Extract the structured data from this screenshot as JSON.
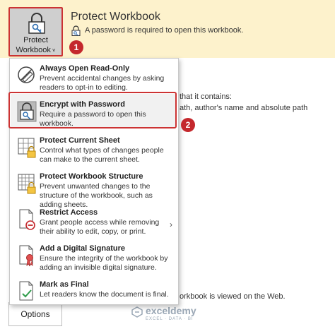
{
  "protect_button": {
    "line1": "Protect",
    "line2": "Workbook",
    "chevron": "˅"
  },
  "banner": {
    "title": "Protect Workbook",
    "description": "A password is required to open this workbook."
  },
  "badges": {
    "first": "1",
    "second": "2"
  },
  "background_texts": {
    "contains": "that it contains:",
    "path": "ath, author's name and absolute path",
    "web": "orkbook is viewed on the Web."
  },
  "options_label": "Options",
  "menu": {
    "items": [
      {
        "title": "Always Open Read-Only",
        "desc": "Prevent accidental changes by asking readers to opt-in to editing.",
        "icon": "pencil-no-icon"
      },
      {
        "title": "Encrypt with Password",
        "desc": "Require a password to open this workbook.",
        "icon": "lock-key-icon"
      },
      {
        "title": "Protect Current Sheet",
        "desc": "Control what types of changes people can make to the current sheet.",
        "icon": "sheet-lock-icon"
      },
      {
        "title": "Protect Workbook Structure",
        "desc": "Prevent unwanted changes to the structure of the workbook, such as adding sheets.",
        "icon": "workbook-lock-icon"
      },
      {
        "title": "Restrict Access",
        "desc": "Grant people access while removing their ability to edit, copy, or print.",
        "icon": "restrict-access-icon",
        "arrow": "›"
      },
      {
        "title": "Add a Digital Signature",
        "desc": "Ensure the integrity of the workbook by adding an invisible digital signature.",
        "icon": "certificate-icon"
      },
      {
        "title": "Mark as Final",
        "desc": "Let readers know the document is final.",
        "icon": "document-check-icon"
      }
    ]
  },
  "watermark": {
    "name": "exceldemy",
    "tagline": "EXCEL · DATA · BI"
  },
  "colors": {
    "banner_bg": "#fdf2cc",
    "highlight": "#cc3333",
    "badge": "#c4282d",
    "button_bg": "#cfcfcf"
  }
}
